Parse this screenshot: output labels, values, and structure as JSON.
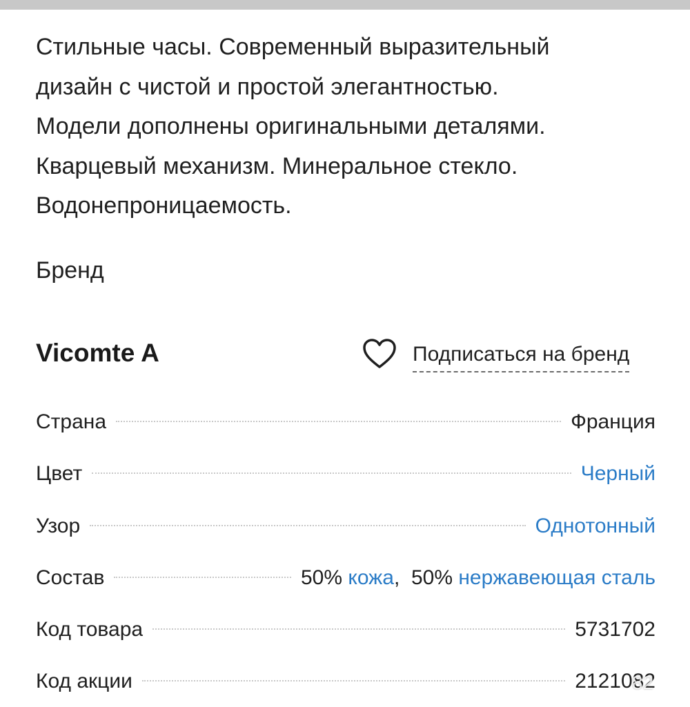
{
  "description": {
    "text": "Стильные часы. Современный выразительный\nдизайн с чистой и простой элегантностью.\nМодели дополнены оригинальными деталями.\nКварцевый механизм. Минеральное стекло.\nВодонепроницаемость."
  },
  "brand": {
    "label": "Бренд",
    "name": "Vicomte A",
    "subscribe_label": "Подписаться на бренд",
    "subscribe_icon": "heart-icon"
  },
  "attributes": {
    "country": {
      "name": "Страна",
      "value": "Франция"
    },
    "color": {
      "name": "Цвет",
      "value": "Черный"
    },
    "pattern": {
      "name": "Узор",
      "value": "Однотонный"
    },
    "composition": {
      "name": "Состав",
      "parts": [
        {
          "percent": "50%",
          "material": "кожа"
        },
        {
          "percent": "50%",
          "material": "нержавеющая сталь"
        }
      ],
      "separator": ","
    },
    "product_code": {
      "name": "Код товара",
      "value": "5731702"
    },
    "promo_code": {
      "name": "Код акции",
      "value": "2121082"
    }
  },
  "overlay": {
    "watermark": "82"
  },
  "colors": {
    "link": "#2b7cc7",
    "text": "#1f1f1f",
    "top_bar": "#c8c8c8"
  }
}
